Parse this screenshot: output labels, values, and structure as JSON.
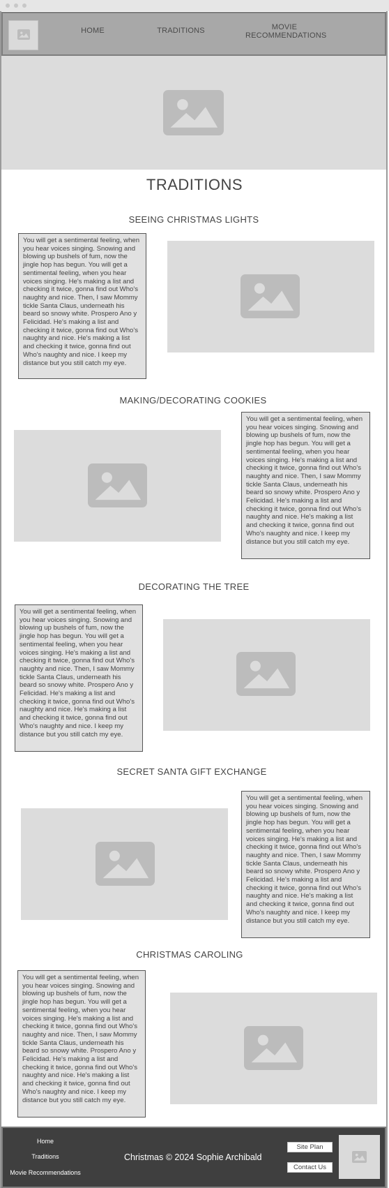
{
  "nav": {
    "home": "HOME",
    "traditions": "TRADITIONS",
    "movies_line1": "MOVIE",
    "movies_line2": "RECOMMENDATIONS"
  },
  "page": {
    "title": "TRADITIONS"
  },
  "sections": [
    {
      "title": "SEEING CHRISTMAS LIGHTS",
      "text": "You will get a sentimental feeling, when you hear voices singing. Snowing and blowing up bushels of fum, now the jingle hop has begun. You will get a sentimental feeling, when you hear voices singing. He's making a list and checking it twice, gonna find out Who's naughty and nice. Then, I saw Mommy tickle Santa Claus, underneath his beard so snowy white. Prospero Ano y Felicidad. He's making a list and checking it twice, gonna find out Who's naughty and nice. He's making a list and checking it twice, gonna find out Who's naughty and nice. I keep my distance but you still catch my eye."
    },
    {
      "title": "MAKING/DECORATING COOKIES",
      "text": "You will get a sentimental feeling, when you hear voices singing. Snowing and blowing up bushels of fum, now the jingle hop has begun. You will get a sentimental feeling, when you hear voices singing. He's making a list and checking it twice, gonna find out Who's naughty and nice. Then, I saw Mommy tickle Santa Claus, underneath his beard so snowy white. Prospero Ano y Felicidad. He's making a list and checking it twice, gonna find out Who's naughty and nice. He's making a list and checking it twice, gonna find out Who's naughty and nice. I keep my distance but you still catch my eye."
    },
    {
      "title": "DECORATING THE TREE",
      "text": "You will get a sentimental feeling, when you hear voices singing. Snowing and blowing up bushels of fum, now the jingle hop has begun. You will get a sentimental feeling, when you hear voices singing. He's making a list and checking it twice, gonna find out Who's naughty and nice. Then, I saw Mommy tickle Santa Claus, underneath his beard so snowy white. Prospero Ano y Felicidad. He's making a list and checking it twice, gonna find out Who's naughty and nice. He's making a list and checking it twice, gonna find out Who's naughty and nice. I keep my distance but you still catch my eye."
    },
    {
      "title": "SECRET SANTA GIFT EXCHANGE",
      "text": "You will get a sentimental feeling, when you hear voices singing. Snowing and blowing up bushels of fum, now the jingle hop has begun. You will get a sentimental feeling, when you hear voices singing. He's making a list and checking it twice, gonna find out Who's naughty and nice. Then, I saw Mommy tickle Santa Claus, underneath his beard so snowy white. Prospero Ano y Felicidad. He's making a list and checking it twice, gonna find out Who's naughty and nice. He's making a list and checking it twice, gonna find out Who's naughty and nice. I keep my distance but you still catch my eye."
    },
    {
      "title": "CHRISTMAS CAROLING",
      "text": "You will get a sentimental feeling, when you hear voices singing. Snowing and blowing up bushels of fum, now the jingle hop has begun. You will get a sentimental feeling, when you hear voices singing. He's making a list and checking it twice, gonna find out Who's naughty and nice. Then, I saw Mommy tickle Santa Claus, underneath his beard so snowy white. Prospero Ano y Felicidad. He's making a list and checking it twice, gonna find out Who's naughty and nice. He's making a list and checking it twice, gonna find out Who's naughty and nice. I keep my distance but you still catch my eye."
    }
  ],
  "footer": {
    "links": [
      "Home",
      "Traditions",
      "Movie Recommendations"
    ],
    "copyright": "Christmas © 2024 Sophie Archibald",
    "site_plan": "Site Plan",
    "contact_us": "Contact Us"
  },
  "colors": {
    "header_bg": "#a8a8a8",
    "footer_bg": "#3f3f3f",
    "placeholder": "#dcdcdc",
    "textbox_bg": "#e1e1e1"
  },
  "icons": {
    "image_placeholder": "image-placeholder-icon"
  }
}
